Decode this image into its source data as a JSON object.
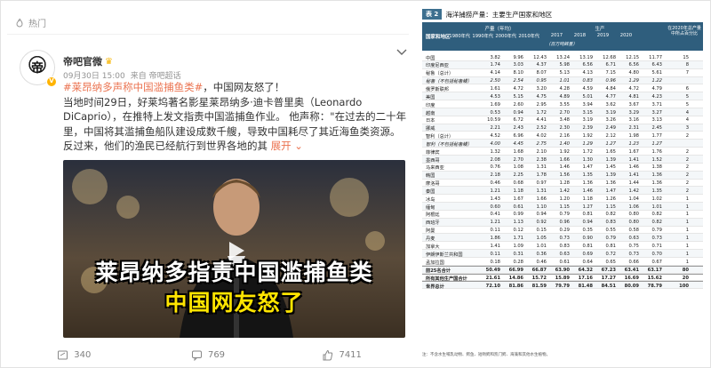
{
  "post": {
    "hot_label": "热门",
    "username": "帝吧官微",
    "time": "09月30日 15:00",
    "source": "来自 帝吧超话",
    "hashtag": "#莱昂纳多声称中国滥捕鱼类#",
    "headline_rest": "，中国网友怒了！",
    "body": "当地时间29日，好莱坞著名影星莱昂纳多·迪卡普里奥（Leonardo DiCaprio），在推特上发文指责中国滥捕鱼作业。 他声称：\"在过去的二十年里，中国将其滥捕鱼船队建设成数千艘，导致中国耗尽了其近海鱼类资源。反过来，他们的渔民已经航行到世界各地的其",
    "expand": "展开",
    "video_caption_1": "莱昂纳多指责中国滥捕鱼类",
    "video_caption_2": "中国网友怒了",
    "repost_count": "340",
    "comment_count": "769",
    "like_count": "7411",
    "accent_color": "#eb7350"
  },
  "table": {
    "badge": "表 2",
    "title": "海洋捕捞产量：主要生产国家和地区",
    "col_header_country": "国家和地区",
    "group_production": "产量（年均）",
    "group_production2": "生产",
    "unit": "（百万吨鲜重）",
    "last_col": "在2020年总产量中所占百分比",
    "years": [
      "1980年代",
      "1990年代",
      "2000年代",
      "2010年代",
      "2017",
      "2018",
      "2019",
      "2020"
    ],
    "rows": [
      {
        "name": "中国",
        "v": [
          "3.82",
          "9.96",
          "12.43",
          "13.24",
          "13.19",
          "12.68",
          "12.15",
          "11.77"
        ],
        "p": "15"
      },
      {
        "name": "印度尼西亚",
        "v": [
          "1.74",
          "3.03",
          "4.37",
          "5.98",
          "6.56",
          "6.71",
          "6.56",
          "6.43"
        ],
        "p": "8"
      },
      {
        "name": "秘鲁（总计）",
        "v": [
          "4.14",
          "8.10",
          "8.07",
          "5.13",
          "4.13",
          "7.15",
          "4.80",
          "5.61",
          "7"
        ]
      },
      {
        "name": "秘鲁（不包括秘鲁鳀）",
        "v": [
          "2.50",
          "2.54",
          "0.95",
          "1.01",
          "0.83",
          "0.96",
          "1.29",
          "1.22"
        ],
        "p": "",
        "i": true
      },
      {
        "name": "俄罗斯联邦",
        "v": [
          "1.61",
          "4.72",
          "3.20",
          "4.28",
          "4.59",
          "4.84",
          "4.72",
          "4.79"
        ],
        "p": "6"
      },
      {
        "name": "美国",
        "v": [
          "4.53",
          "5.15",
          "4.75",
          "4.89",
          "5.01",
          "4.77",
          "4.81",
          "4.23"
        ],
        "p": "5"
      },
      {
        "name": "印度",
        "v": [
          "1.69",
          "2.60",
          "2.95",
          "3.55",
          "3.94",
          "3.62",
          "3.67",
          "3.71"
        ],
        "p": "5"
      },
      {
        "name": "越南",
        "v": [
          "0.53",
          "0.94",
          "1.72",
          "2.70",
          "3.15",
          "3.19",
          "3.29",
          "3.27"
        ],
        "p": "4"
      },
      {
        "name": "日本",
        "v": [
          "10.59",
          "6.72",
          "4.41",
          "3.48",
          "3.19",
          "3.26",
          "3.16",
          "3.13"
        ],
        "p": "4"
      },
      {
        "name": "挪威",
        "v": [
          "2.21",
          "2.43",
          "2.52",
          "2.30",
          "2.39",
          "2.49",
          "2.31",
          "2.45"
        ],
        "p": "3"
      },
      {
        "name": "智利（总计）",
        "v": [
          "4.52",
          "6.96",
          "4.02",
          "2.16",
          "1.92",
          "2.12",
          "1.98",
          "1.77"
        ],
        "p": "2"
      },
      {
        "name": "智利（不包括秘鲁鳀）",
        "v": [
          "4.00",
          "4.45",
          "2.75",
          "1.40",
          "1.29",
          "1.27",
          "1.23",
          "1.27"
        ],
        "p": "",
        "i": true
      },
      {
        "name": "菲律宾",
        "v": [
          "1.32",
          "1.68",
          "2.10",
          "1.92",
          "1.72",
          "1.65",
          "1.67",
          "1.76"
        ],
        "p": "2"
      },
      {
        "name": "墨西哥",
        "v": [
          "2.08",
          "2.70",
          "2.38",
          "1.66",
          "1.30",
          "1.39",
          "1.41",
          "1.52"
        ],
        "p": "2"
      },
      {
        "name": "马来西亚",
        "v": [
          "0.76",
          "1.08",
          "1.31",
          "1.46",
          "1.47",
          "1.45",
          "1.46",
          "1.38"
        ],
        "p": "2"
      },
      {
        "name": "韩国",
        "v": [
          "2.18",
          "2.25",
          "1.78",
          "1.56",
          "1.35",
          "1.39",
          "1.41",
          "1.36"
        ],
        "p": "2"
      },
      {
        "name": "摩洛哥",
        "v": [
          "0.46",
          "0.68",
          "0.97",
          "1.28",
          "1.36",
          "1.36",
          "1.44",
          "1.36"
        ],
        "p": "2"
      },
      {
        "name": "秦国",
        "v": [
          "1.21",
          "1.18",
          "1.31",
          "1.42",
          "1.46",
          "1.47",
          "1.42",
          "1.35"
        ],
        "p": "2"
      },
      {
        "name": "冰岛",
        "v": [
          "1.43",
          "1.67",
          "1.66",
          "1.20",
          "1.18",
          "1.26",
          "1.04",
          "1.02"
        ],
        "p": "1"
      },
      {
        "name": "缅甸",
        "v": [
          "0.60",
          "0.61",
          "1.10",
          "1.15",
          "1.27",
          "1.15",
          "1.06",
          "1.01"
        ],
        "p": "1"
      },
      {
        "name": "阿根廷",
        "v": [
          "0.41",
          "0.99",
          "0.94",
          "0.79",
          "0.81",
          "0.82",
          "0.80",
          "0.82"
        ],
        "p": "1"
      },
      {
        "name": "西班牙",
        "v": [
          "1.21",
          "1.13",
          "0.92",
          "0.96",
          "0.94",
          "0.83",
          "0.80",
          "0.82"
        ],
        "p": "1"
      },
      {
        "name": "阿曼",
        "v": [
          "0.11",
          "0.12",
          "0.15",
          "0.29",
          "0.35",
          "0.55",
          "0.58",
          "0.79"
        ],
        "p": "1"
      },
      {
        "name": "丹麦",
        "v": [
          "1.86",
          "1.71",
          "1.05",
          "0.73",
          "0.90",
          "0.79",
          "0.63",
          "0.73"
        ],
        "p": "1"
      },
      {
        "name": "加拿大",
        "v": [
          "1.41",
          "1.09",
          "1.01",
          "0.83",
          "0.81",
          "0.81",
          "0.75",
          "0.71"
        ],
        "p": "1"
      },
      {
        "name": "伊朗伊斯兰共和国",
        "v": [
          "0.11",
          "0.31",
          "0.36",
          "0.63",
          "0.69",
          "0.72",
          "0.73",
          "0.70"
        ],
        "p": "1"
      },
      {
        "name": "孟加拉国",
        "v": [
          "0.18",
          "0.28",
          "0.46",
          "0.61",
          "0.64",
          "0.65",
          "0.66",
          "0.67"
        ],
        "p": "1"
      },
      {
        "name": "前25名合计",
        "v": [
          "50.49",
          "66.99",
          "66.87",
          "63.90",
          "64.32",
          "67.23",
          "63.41",
          "63.17"
        ],
        "p": "80",
        "sum": true
      },
      {
        "name": "所有其他生产国合计",
        "v": [
          "21.61",
          "14.86",
          "15.72",
          "15.89",
          "17.16",
          "17.27",
          "16.69",
          "15.62"
        ],
        "p": "20",
        "sum": true
      },
      {
        "name": "世界总计",
        "v": [
          "72.10",
          "81.86",
          "81.59",
          "79.79",
          "81.48",
          "84.51",
          "80.09",
          "78.79"
        ],
        "p": "100",
        "sum": true
      }
    ],
    "footnote": "注：不含水生哺乳动物、鳄鱼、短吻鳄和凯门鳄、海藻和其他水生植物。"
  }
}
